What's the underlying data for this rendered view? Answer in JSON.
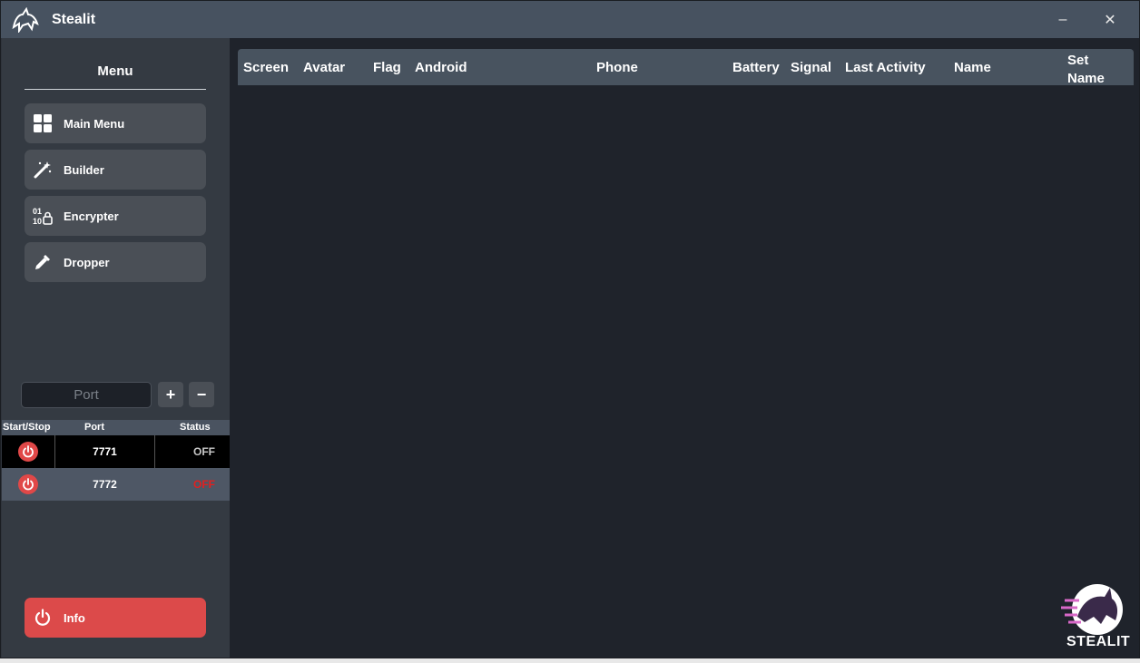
{
  "window": {
    "title": "Stealit",
    "minimize": "–",
    "close": "✕"
  },
  "sidebar": {
    "menu_title": "Menu",
    "items": [
      {
        "label": "Main Menu",
        "icon": "grid-icon"
      },
      {
        "label": "Builder",
        "icon": "magic-wand-icon"
      },
      {
        "label": "Encrypter",
        "icon": "binary-lock-icon"
      },
      {
        "label": "Dropper",
        "icon": "eyedropper-icon"
      }
    ],
    "port_placeholder": "Port",
    "add_label": "+",
    "remove_label": "−",
    "port_table": {
      "headers": [
        "Start/Stop",
        "Port",
        "Status"
      ],
      "rows": [
        {
          "port": "7771",
          "status": "OFF",
          "status_color": "#c8c8c8"
        },
        {
          "port": "7772",
          "status": "OFF",
          "status_color": "#e02020"
        }
      ]
    },
    "info_label": "Info"
  },
  "table": {
    "columns": [
      "Screen",
      "Avatar",
      "Flag",
      "Android",
      "Phone",
      "Battery",
      "Signal",
      "Last Activity",
      "Name",
      "Set Name"
    ]
  },
  "brand": {
    "text": "STEALIT",
    "accent": "#e04848"
  }
}
